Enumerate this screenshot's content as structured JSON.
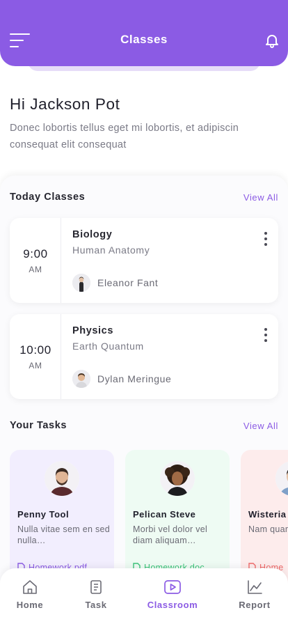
{
  "header": {
    "title": "Classes",
    "menu_icon": "hamburger-menu-icon",
    "bell_icon": "bell-icon"
  },
  "colors": {
    "accent": "#8b5be4",
    "task_card_1": "#f2eefe",
    "task_card_2": "#eefbf3",
    "task_card_3": "#fdecec",
    "file_green": "#3cc47a",
    "file_red": "#ef6a6a"
  },
  "greeting": {
    "title": "Hi Jackson Pot",
    "subtitle": "Donec lobortis tellus eget mi lobortis, et adipiscin consequat elit consequat"
  },
  "today_classes": {
    "title": "Today Classes",
    "view_all": "View All",
    "items": [
      {
        "time": "9:00",
        "period": "AM",
        "subject": "Biology",
        "topic": "Human Anatomy",
        "teacher": "Eleanor Fant"
      },
      {
        "time": "10:00",
        "period": "AM",
        "subject": "Physics",
        "topic": "Earth Quantum",
        "teacher": "Dylan Meringue"
      }
    ]
  },
  "tasks": {
    "title": "Your Tasks",
    "view_all": "View All",
    "items": [
      {
        "name": "Penny Tool",
        "description": "Nulla vitae sem en sed nulla…",
        "file": "Homework.pdf"
      },
      {
        "name": "Pelican Steve",
        "description": "Morbi vel dolor vel diam aliquam…",
        "file": "Homework.doc"
      },
      {
        "name": "Wisteria",
        "description": "Nam quam finibus et",
        "file": "Home"
      }
    ]
  },
  "bottom_nav": [
    {
      "label": "Home",
      "icon": "home-icon"
    },
    {
      "label": "Task",
      "icon": "task-icon"
    },
    {
      "label": "Classroom",
      "icon": "play-icon",
      "active": true
    },
    {
      "label": "Report",
      "icon": "chart-icon"
    }
  ]
}
